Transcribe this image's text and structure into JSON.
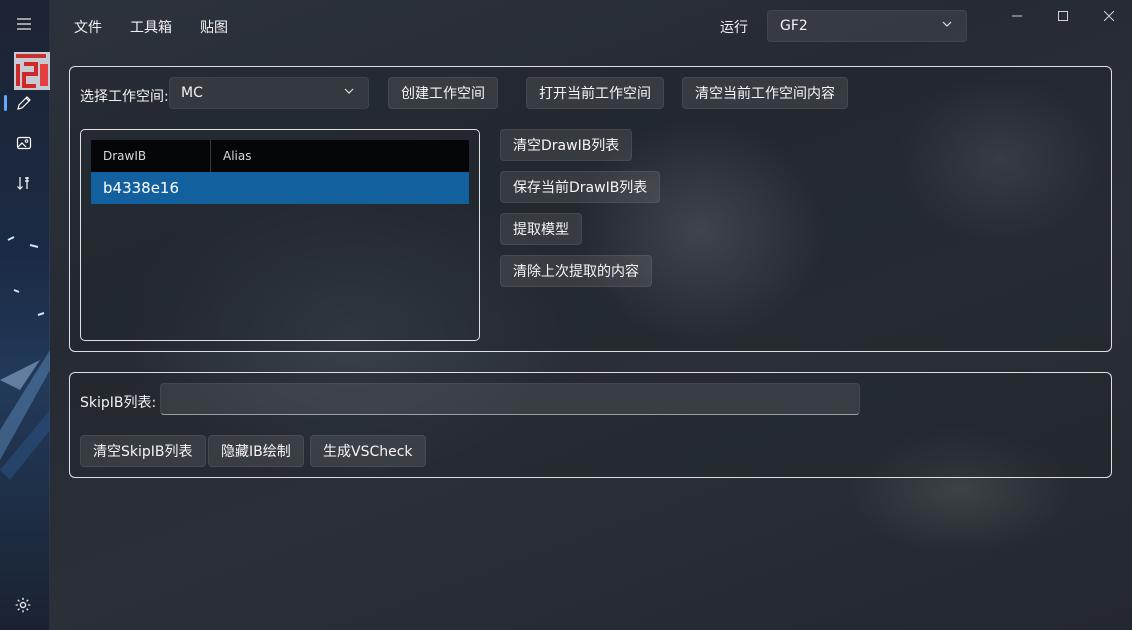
{
  "menu": {
    "file": "文件",
    "toolbox": "工具箱",
    "texture": "贴图"
  },
  "run": {
    "label": "运行",
    "selected": "GF2"
  },
  "nav": {
    "items": [
      "menu-icon",
      "pencil-icon",
      "image-icon",
      "sort-icon",
      "gear-icon"
    ],
    "active": "pencil-icon"
  },
  "workspace": {
    "label": "选择工作空间:",
    "selected": "MC",
    "create_button": "创建工作空间",
    "open_button": "打开当前工作空间",
    "clear_button": "清空当前工作空间内容"
  },
  "drawib_grid": {
    "columns": [
      "DrawIB",
      "Alias"
    ],
    "rows": [
      {
        "drawib": "b4338e16",
        "alias": ""
      }
    ]
  },
  "drawib_actions": {
    "clear_list": "清空DrawIB列表",
    "save_list": "保存当前DrawIB列表",
    "extract_model": "提取模型",
    "clear_last_extract": "清除上次提取的内容"
  },
  "skipib": {
    "label": "SkipIB列表:",
    "value": "",
    "clear_button": "清空SkipIB列表",
    "hide_button": "隐藏IB绘制",
    "vscheck_button": "生成VSCheck"
  },
  "colors": {
    "accent": "#60a8ff",
    "selected_row": "#12609e",
    "grid_header": "#050607"
  }
}
